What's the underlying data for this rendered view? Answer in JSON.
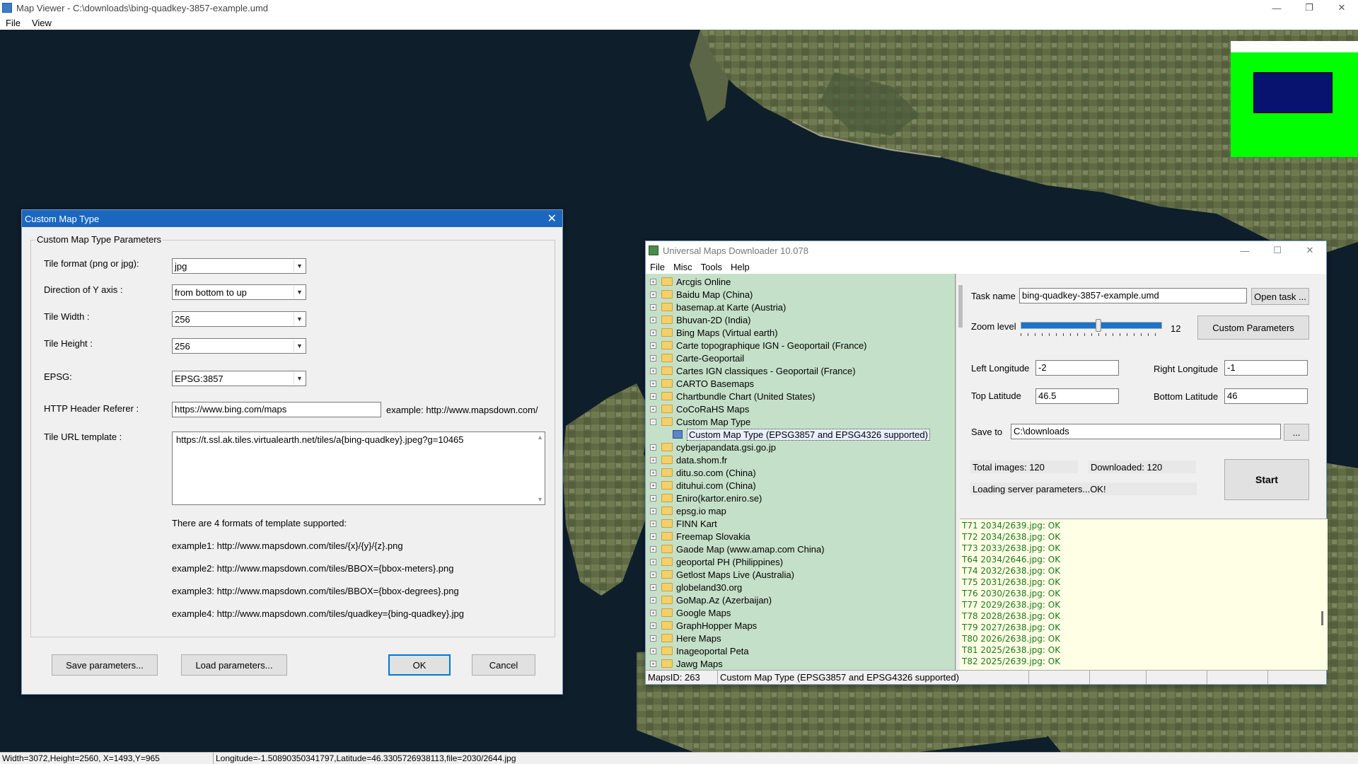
{
  "main_window": {
    "title": "Map Viewer - C:\\downloads\\bing-quadkey-3857-example.umd",
    "menu": [
      "File",
      "View"
    ],
    "controls": [
      "—",
      "❐",
      "✕"
    ],
    "status": {
      "size_info": "Width=3072,Height=2560, X=1493,Y=965",
      "geo_info": "Longitude=-1.50890350341797,Latitude=46.3305726938113,file=2030/2644.jpg"
    }
  },
  "custom_map_dialog": {
    "title": "Custom Map Type",
    "close": "✕",
    "group_title": "Custom Map Type Parameters",
    "tile_format_label": "Tile format (png or jpg):",
    "tile_format_value": "jpg",
    "y_axis_label": "Direction of Y axis :",
    "y_axis_value": "from bottom to up",
    "tile_width_label": "Tile Width :",
    "tile_width_value": "256",
    "tile_height_label": "Tile Height :",
    "tile_height_value": "256",
    "epsg_label": "EPSG:",
    "epsg_value": "EPSG:3857",
    "referer_label": "HTTP Header Referer :",
    "referer_value": "https://www.bing.com/maps",
    "referer_example": "example: http://www.mapsdown.com/",
    "url_label": "Tile URL template :",
    "url_value": "https://t.ssl.ak.tiles.virtualearth.net/tiles/a{bing-quadkey}.jpeg?g=10465",
    "formats_note": "There are 4 formats of template supported:",
    "example1": "example1: http://www.mapsdown.com/tiles/{x}/{y}/{z}.png",
    "example2": "example2: http://www.mapsdown.com/tiles/BBOX={bbox-meters}.png",
    "example3": "example3: http://www.mapsdown.com/tiles/BBOX={bbox-degrees}.png",
    "example4": "example4: http://www.mapsdown.com/tiles/quadkey={bing-quadkey}.jpg",
    "save_button": "Save parameters...",
    "load_button": "Load parameters...",
    "ok_button": "OK",
    "cancel_button": "Cancel"
  },
  "umd": {
    "title": "Universal Maps Downloader 10.078",
    "controls": [
      "—",
      "☐",
      "✕"
    ],
    "menu": [
      "File",
      "Misc",
      "Tools",
      "Help"
    ],
    "tree": [
      {
        "label": "Arcgis Online",
        "exp": "+"
      },
      {
        "label": "Baidu Map (China)",
        "exp": "+"
      },
      {
        "label": "basemap.at Karte (Austria)",
        "exp": "+"
      },
      {
        "label": "Bhuvan-2D (India)",
        "exp": "+"
      },
      {
        "label": "Bing Maps (Virtual earth)",
        "exp": "+"
      },
      {
        "label": "Carte topographique IGN - Geoportail (France)",
        "exp": "+"
      },
      {
        "label": "Carte-Geoportail",
        "exp": "+"
      },
      {
        "label": "Cartes IGN classiques - Geoportail (France)",
        "exp": "+"
      },
      {
        "label": "CARTO Basemaps",
        "exp": "+"
      },
      {
        "label": "Chartbundle Chart (United States)",
        "exp": "+"
      },
      {
        "label": "CoCoRaHS Maps",
        "exp": "+"
      },
      {
        "label": "Custom Map Type",
        "exp": "−"
      },
      {
        "label": "Custom Map Type (EPSG3857 and EPSG4326 supported)",
        "child": true
      },
      {
        "label": "cyberjapandata.gsi.go.jp",
        "exp": "+"
      },
      {
        "label": "data.shom.fr",
        "exp": "+"
      },
      {
        "label": "ditu.so.com (China)",
        "exp": "+"
      },
      {
        "label": "dituhui.com (China)",
        "exp": "+"
      },
      {
        "label": "Eniro(kartor.eniro.se)",
        "exp": "+"
      },
      {
        "label": "epsg.io map",
        "exp": "+"
      },
      {
        "label": "FINN Kart",
        "exp": "+"
      },
      {
        "label": "Freemap Slovakia",
        "exp": "+"
      },
      {
        "label": "Gaode Map (www.amap.com China)",
        "exp": "+"
      },
      {
        "label": "geoportal PH (Philippines)",
        "exp": "+"
      },
      {
        "label": "Getlost Maps Live (Australia)",
        "exp": "+"
      },
      {
        "label": "globeland30.org",
        "exp": "+"
      },
      {
        "label": "GoMap.Az (Azerbaijan)",
        "exp": "+"
      },
      {
        "label": "Google Maps",
        "exp": "+"
      },
      {
        "label": "GraphHopper Maps",
        "exp": "+"
      },
      {
        "label": "Here Maps",
        "exp": "+"
      },
      {
        "label": "Inageoportal Peta",
        "exp": "+"
      },
      {
        "label": "Jawg Maps",
        "exp": "+"
      }
    ],
    "task_name_label": "Task name",
    "task_name_value": "bing-quadkey-3857-example.umd",
    "open_task_button": "Open task ...",
    "zoom_label": "Zoom level",
    "zoom_value": "12",
    "zoom_fraction": 0.55,
    "custom_params_button": "Custom Parameters",
    "left_lon_label": "Left Longitude",
    "left_lon_value": "-2",
    "right_lon_label": "Right Longitude",
    "right_lon_value": "-1",
    "top_lat_label": "Top Latitude",
    "top_lat_value": "46.5",
    "bottom_lat_label": "Bottom Latitude",
    "bottom_lat_value": "46",
    "save_to_label": "Save to",
    "save_to_value": "C:\\downloads",
    "browse_button": "...",
    "total_images": "Total images: 120",
    "downloaded": "Downloaded: 120",
    "loading_status": "Loading server parameters...OK!",
    "start_button": "Start",
    "log": [
      "T71 2034/2639.jpg: OK",
      "T72 2034/2638.jpg: OK",
      "T73 2033/2638.jpg: OK",
      "T64 2034/2646.jpg: OK",
      "T74 2032/2638.jpg: OK",
      "T75 2031/2638.jpg: OK",
      "T76 2030/2638.jpg: OK",
      "T77 2029/2638.jpg: OK",
      "T78 2028/2638.jpg: OK",
      "T79 2027/2638.jpg: OK",
      "T80 2026/2638.jpg: OK",
      "T81 2025/2638.jpg: OK",
      "T82 2025/2639.jpg: OK"
    ],
    "status_maps_id": "MapsID: 263",
    "status_map_name": "Custom Map Type (EPSG3857 and EPSG4326 supported)"
  }
}
